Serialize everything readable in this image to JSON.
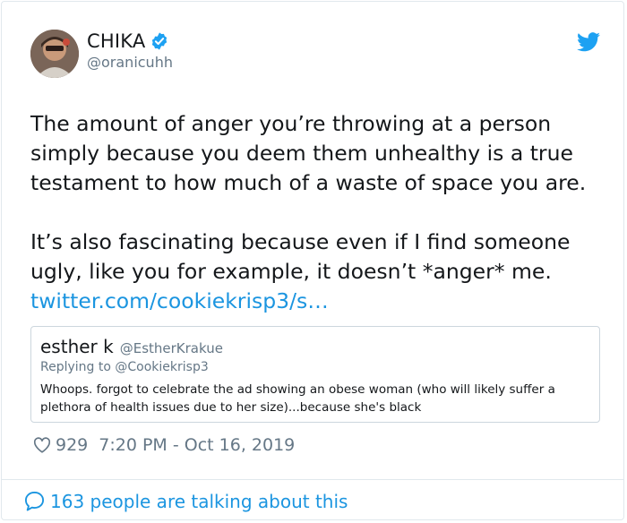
{
  "author": {
    "display_name": "CHIKA",
    "handle": "@oranicuhh"
  },
  "icons": {
    "avatar": "profile-photo",
    "verified": "verified-badge-icon",
    "brand": "twitter-bird-icon",
    "like": "heart-icon",
    "talking": "speech-bubble-icon"
  },
  "colors": {
    "accent": "#1b95e0",
    "muted": "#657786",
    "text": "#14171a",
    "border": "#e1e8ed"
  },
  "tweet": {
    "paragraph1": "The amount of anger you’re throwing at a person simply because you deem them unhealthy is a true testament to how much of a waste of space you are.",
    "paragraph2": "It’s also fascinating because even if I find someone ugly, like you for example, it doesn’t *anger* me.",
    "link": "twitter.com/cookiekrisp3/s…"
  },
  "quoted": {
    "display_name": "esther k",
    "handle": "@EstherKrakue",
    "replying_to": "Replying to @Cookiekrisp3",
    "text": "Whoops. forgot to celebrate the ad showing an obese woman (who will likely suffer a plethora of health issues due to her size)...because she's black"
  },
  "meta": {
    "likes": "929",
    "timestamp": "7:20 PM - Oct 16, 2019"
  },
  "footer": {
    "talking": "163 people are talking about this"
  }
}
